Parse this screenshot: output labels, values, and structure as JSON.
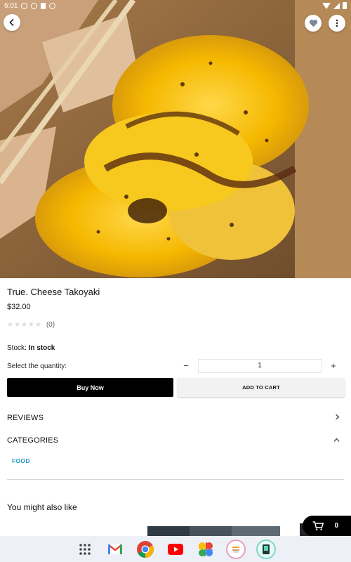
{
  "status_bar": {
    "time": "6:01"
  },
  "product": {
    "title": "True. Cheese Takoyaki",
    "price": "$32.00",
    "rating_stars": 0,
    "rating_count": "(0)",
    "stock_label": "Stock:",
    "stock_value": "In stock",
    "quantity_label": "Select the quantity:",
    "quantity_value": "1",
    "minus_label": "−",
    "plus_label": "+"
  },
  "actions": {
    "buy_now": "Buy Now",
    "add_to_cart": "ADD TO CART"
  },
  "sections": {
    "reviews": "REVIEWS",
    "categories": "CATEGORIES",
    "category_tags": [
      "FOOD"
    ]
  },
  "recommendations": {
    "title": "You might also like"
  },
  "cart": {
    "count": "0"
  },
  "icons": {
    "back": "back-arrow-icon",
    "favorite": "heart-icon",
    "more": "more-vert-icon",
    "cart": "shopping-cart-icon",
    "reviews_chevron": "chevron-right-icon",
    "categories_chevron": "chevron-up-icon"
  },
  "dock_apps": [
    "app-drawer",
    "gmail",
    "chrome",
    "youtube",
    "photos",
    "app-5",
    "app-6"
  ],
  "colors": {
    "accent": "#2196c6",
    "primary_button": "#000000",
    "secondary_button": "#f2f2f2"
  }
}
